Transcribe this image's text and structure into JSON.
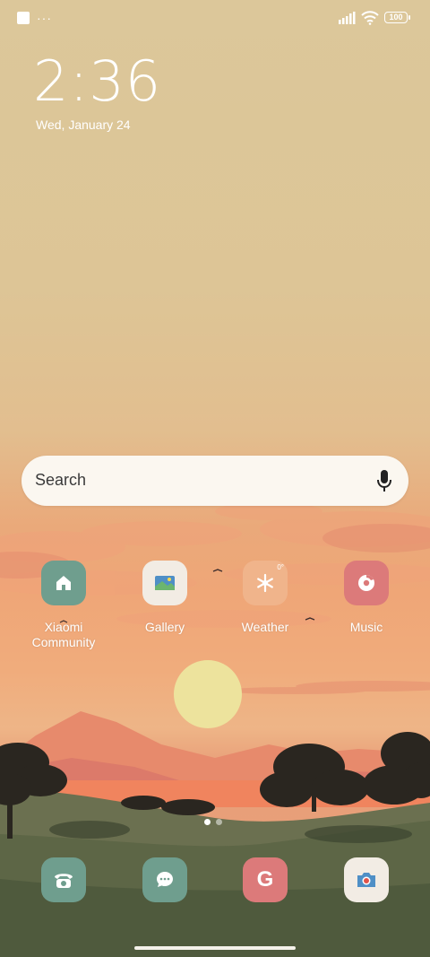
{
  "status_bar": {
    "battery": "100",
    "more_indicator": "···"
  },
  "lockclock": {
    "time": "2:36",
    "date": "Wed, January 24"
  },
  "search": {
    "placeholder": "Search"
  },
  "apps_row": [
    {
      "label": "Xiaomi Community",
      "icon": "house-icon",
      "color": "#6f9e8e"
    },
    {
      "label": "Gallery",
      "icon": "image-icon",
      "color": "#f2ece4"
    },
    {
      "label": "Weather",
      "icon": "snowflake-icon",
      "color": "#f0b48b",
      "badge": "0°"
    },
    {
      "label": "Music",
      "icon": "music-disc-icon",
      "color": "#dc7a7a"
    }
  ],
  "dock": [
    {
      "name": "phone",
      "icon": "phone-icon",
      "color": "#6f9e8e"
    },
    {
      "name": "messages",
      "icon": "chat-bubble-icon",
      "color": "#6f9e8e"
    },
    {
      "name": "google",
      "icon": "google-icon",
      "color": "#dc7a7a",
      "glyph": "G"
    },
    {
      "name": "camera",
      "icon": "camera-icon",
      "color": "#f2ece4"
    }
  ],
  "colors": {
    "sky_top": "#dcc79a",
    "sky_sunset": "#efa677",
    "sun": "#ede39d",
    "ground": "#5a6a4a"
  }
}
